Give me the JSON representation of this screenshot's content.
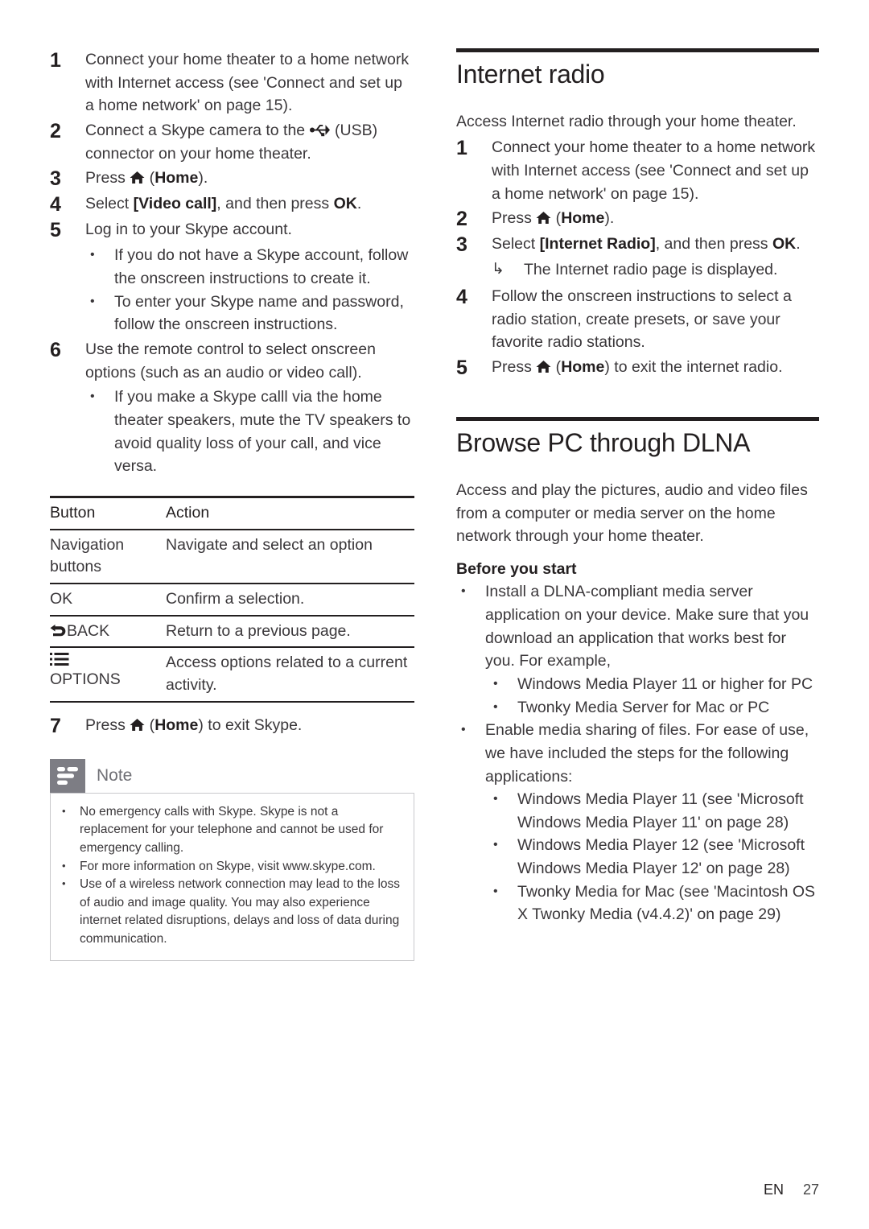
{
  "footer": {
    "language": "EN",
    "page_number": "27"
  },
  "left_column": {
    "skype_steps": [
      {
        "num": "1",
        "html": "Connect your home theater to a home network with Internet access (see 'Connect and set up a home network' on page 15)."
      },
      {
        "num": "2",
        "html": "Connect a Skype camera to the <span class=\"icon\" data-name=\"usb-icon\" data-interactable=\"false\"><svg width=\"26\" height=\"17\" viewBox=\"0 0 26 17\"><g fill=\"#231f20\"><circle cx=\"3\" cy=\"8.5\" r=\"3\"/><rect x=\"3\" y=\"7.6\" width=\"17\" height=\"1.9\"/><path d=\"M19.5 2.2 L25 8.5 L19.5 14.8 Z\"/><path d=\"M8.5 8.5 L12.5 3.2\" stroke=\"#231f20\" stroke-width=\"1.9\" fill=\"none\"/><path d=\"M12 2 h4.2 v1.8 h-4.2 z\"/><path d=\"M11 8.5 L15 14\" stroke=\"#231f20\" stroke-width=\"1.9\" fill=\"none\"/><rect x=\"14.2\" y=\"12.2\" width=\"4\" height=\"4\"/></g></svg></span> (USB) connector on your home theater."
      },
      {
        "num": "3",
        "html": "Press <span class=\"icon\" data-name=\"home-icon\" data-interactable=\"false\"><svg width=\"19\" height=\"17\" viewBox=\"0 0 19 17\"><path d=\"M9.5 1 L18.5 9 L15.8 9 L15.8 16 L11.9 16 L11.9 11 L7.1 11 L7.1 16 L3.2 16 L3.2 9 L0.5 9 Z\" fill=\"#231f20\"/></svg></span> (<b>Home</b>)."
      },
      {
        "num": "4",
        "html": "Select <b>[Video call]</b>, and then press <b>OK</b>."
      },
      {
        "num": "5",
        "html": "Log in to your Skype account."
      }
    ],
    "step5_bullets": [
      "If you do not have a Skype account, follow the onscreen instructions to create it.",
      "To enter your Skype name and password, follow the onscreen instructions."
    ],
    "step6": {
      "num": "6",
      "html": "Use the remote control to select onscreen options (such as an audio or video call)."
    },
    "step6_bullets": [
      "If you make a Skype calll via the home theater speakers, mute the TV speakers to avoid quality loss of your call, and vice versa."
    ],
    "table": {
      "headers": [
        "Button",
        "Action"
      ],
      "rows": [
        {
          "button": "Navigation buttons",
          "button_icon": "",
          "action": "Navigate and select an option"
        },
        {
          "button": "OK",
          "button_icon": "",
          "action": "Confirm a selection."
        },
        {
          "button": "BACK",
          "button_icon": "back-arrow-icon",
          "action": "Return to a previous page."
        },
        {
          "button": "OPTIONS",
          "button_icon": "options-list-icon",
          "action": "Access options related to a current activity."
        }
      ]
    },
    "step7": {
      "num": "7",
      "html": "Press <span class=\"icon\" data-name=\"home-icon\" data-interactable=\"false\"><svg width=\"19\" height=\"17\" viewBox=\"0 0 19 17\"><path d=\"M9.5 1 L18.5 9 L15.8 9 L15.8 16 L11.9 16 L11.9 11 L7.1 11 L7.1 16 L3.2 16 L3.2 9 L0.5 9 Z\" fill=\"#231f20\"/></svg></span> (<b>Home</b>) to exit Skype."
    },
    "note": {
      "title": "Note",
      "items": [
        "No emergency calls with Skype. Skype is not a replacement for your telephone and cannot be used for emergency calling.",
        "For more information on Skype, visit www.skype.com.",
        "Use of a wireless network connection may lead to the loss of audio and image quality. You may also experience internet related disruptions, delays and loss of data during communication."
      ]
    }
  },
  "right_column": {
    "internet_radio": {
      "title": "Internet radio",
      "intro": "Access Internet radio through your home theater.",
      "steps": [
        {
          "num": "1",
          "html": "Connect your home theater to a home network with Internet access (see 'Connect and set up a home network' on page 15)."
        },
        {
          "num": "2",
          "html": "Press <span class=\"icon\" data-name=\"home-icon\" data-interactable=\"false\"><svg width=\"19\" height=\"17\" viewBox=\"0 0 19 17\"><path d=\"M9.5 1 L18.5 9 L15.8 9 L15.8 16 L11.9 16 L11.9 11 L7.1 11 L7.1 16 L3.2 16 L3.2 9 L0.5 9 Z\" fill=\"#231f20\"/></svg></span> (<b>Home</b>)."
        },
        {
          "num": "3",
          "html": "Select <b>[Internet Radio]</b>, and then press <b>OK</b>."
        }
      ],
      "step3_result": "The Internet radio page is displayed.",
      "steps_cont": [
        {
          "num": "4",
          "html": "Follow the onscreen instructions to select a radio station, create presets, or save your favorite radio stations."
        },
        {
          "num": "5",
          "html": "Press <span class=\"icon\" data-name=\"home-icon\" data-interactable=\"false\"><svg width=\"19\" height=\"17\" viewBox=\"0 0 19 17\"><path d=\"M9.5 1 L18.5 9 L15.8 9 L15.8 16 L11.9 16 L11.9 11 L7.1 11 L7.1 16 L3.2 16 L3.2 9 L0.5 9 Z\" fill=\"#231f20\"/></svg></span> (<b>Home</b>) to exit the internet radio."
        }
      ]
    },
    "dlna": {
      "title": "Browse PC through DLNA",
      "intro": "Access and play the pictures, audio and video files from a computer or media server on the home network through your home theater.",
      "subhead": "Before you start",
      "bullet1": "Install a DLNA-compliant media server application on your device. Make sure that you download an application that works best for you. For example,",
      "bullet1_sub": [
        "Windows Media Player 11 or higher for PC",
        "Twonky Media Server for Mac or PC"
      ],
      "bullet2": "Enable media sharing of files. For ease of use, we have included the steps for the following applications:",
      "bullet2_sub": [
        "Windows Media Player 11 (see 'Microsoft Windows Media Player 11' on page 28)",
        "Windows Media Player 12 (see 'Microsoft Windows Media Player 12' on page 28)",
        "Twonky Media for Mac (see 'Macintosh OS X Twonky Media (v4.4.2)' on page 29)"
      ]
    }
  }
}
